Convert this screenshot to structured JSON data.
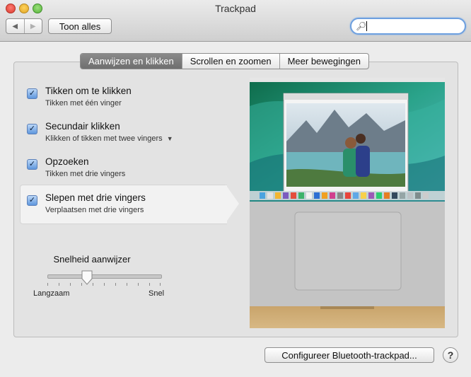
{
  "window": {
    "title": "Trackpad"
  },
  "toolbar": {
    "back_icon": "back-arrow",
    "forward_icon": "forward-arrow",
    "show_all_label": "Toon alles",
    "search_value": ""
  },
  "tabs": [
    {
      "label": "Aanwijzen en klikken",
      "active": true
    },
    {
      "label": "Scrollen en zoomen",
      "active": false
    },
    {
      "label": "Meer bewegingen",
      "active": false
    }
  ],
  "options": [
    {
      "title": "Tikken om te klikken",
      "subtitle": "Tikken met één vinger",
      "checked": true,
      "has_menu": false
    },
    {
      "title": "Secundair klikken",
      "subtitle": "Klikken of tikken met twee vingers",
      "checked": true,
      "has_menu": true
    },
    {
      "title": "Opzoeken",
      "subtitle": "Tikken met drie vingers",
      "checked": true,
      "has_menu": false
    },
    {
      "title": "Slepen met drie vingers",
      "subtitle": "Verplaatsen met drie vingers",
      "checked": true,
      "has_menu": false,
      "selected": true
    }
  ],
  "speed": {
    "label": "Snelheid aanwijzer",
    "min_label": "Langzaam",
    "max_label": "Snel",
    "value_fraction": 0.35
  },
  "footer": {
    "bluetooth_button": "Configureer Bluetooth-trackpad...",
    "help_label": "?"
  }
}
